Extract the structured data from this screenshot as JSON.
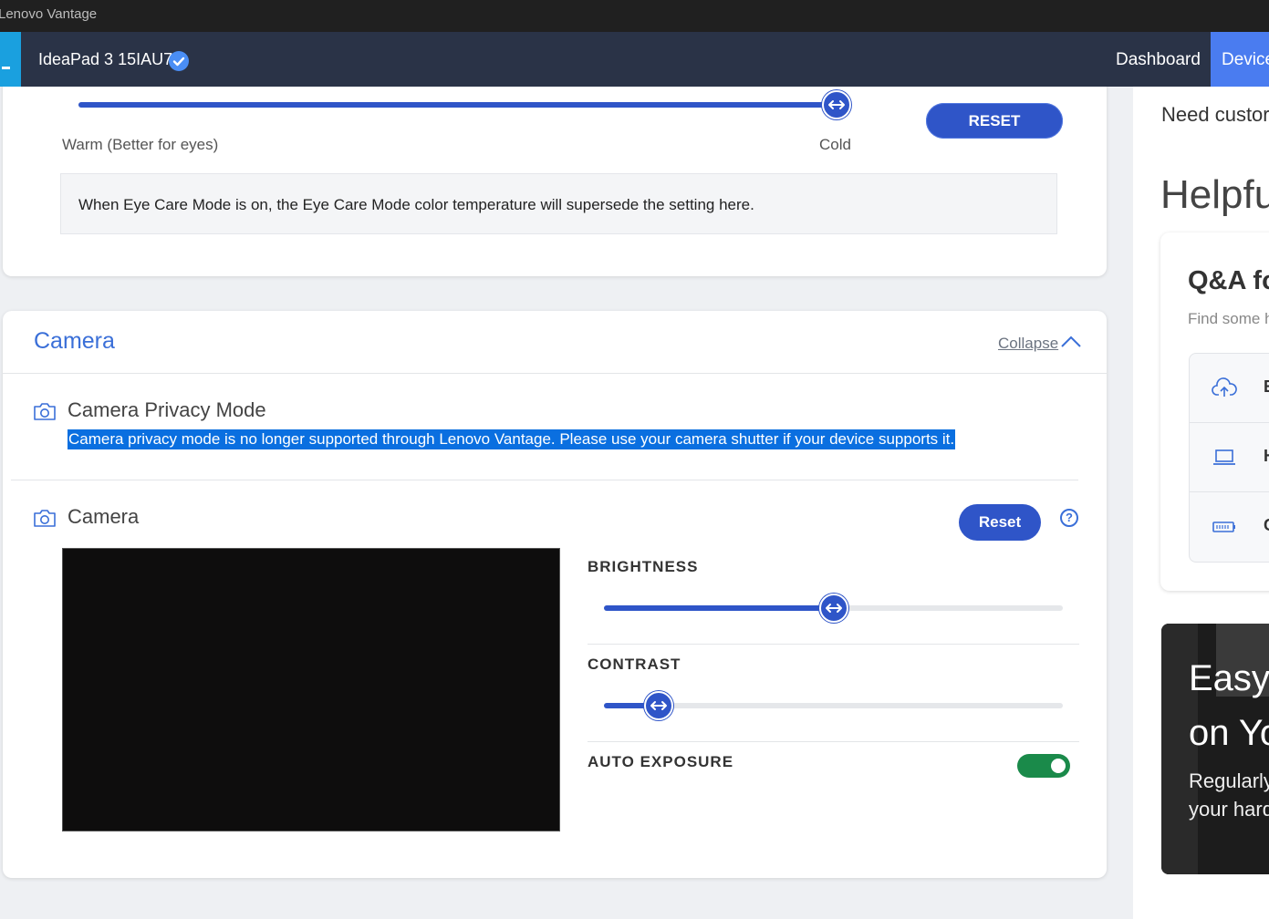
{
  "window": {
    "title": "Lenovo Vantage"
  },
  "header": {
    "device_name": "IdeaPad 3 15IAU7",
    "nav": {
      "dashboard": "Dashboard",
      "device": "Device"
    }
  },
  "color_temperature": {
    "warm_label": "Warm (Better for eyes)",
    "cold_label": "Cold",
    "level": 1.0,
    "reset_label": "RESET",
    "note": "When Eye Care Mode is on, the Eye Care Mode color temperature will supersede the setting here."
  },
  "camera": {
    "section_title": "Camera",
    "collapse_label": "Collapse",
    "privacy_mode": {
      "title": "Camera Privacy Mode",
      "description": "Camera privacy mode is no longer supported through Lenovo Vantage. Please use your camera shutter if your device supports it."
    },
    "camera_row": {
      "title": "Camera",
      "reset_label": "Reset",
      "help_glyph": "?"
    },
    "brightness": {
      "label": "BRIGHTNESS",
      "level": 0.5
    },
    "contrast": {
      "label": "CONTRAST",
      "level": 0.12
    },
    "auto_exposure": {
      "label": "AUTO EXPOSURE",
      "enabled": true
    }
  },
  "right_panel": {
    "need_support": "Need custor",
    "helpful_heading": "Helpfu",
    "qa": {
      "title": "Q&A fc",
      "subtitle": "Find some h",
      "items": [
        {
          "icon": "cloud-upload-icon",
          "letter": "E"
        },
        {
          "icon": "laptop-icon",
          "letter": "H"
        },
        {
          "icon": "battery-icon",
          "letter": "C"
        }
      ]
    },
    "promo": {
      "line1": "Easy",
      "line2": "on Yo",
      "line3": "Regularly",
      "line4": "your hard"
    }
  },
  "colors": {
    "accent_blue": "#2f55c8",
    "header_bg": "#2a3347",
    "toggle_on": "#1a8a4a",
    "selection": "#0a6fe0"
  }
}
